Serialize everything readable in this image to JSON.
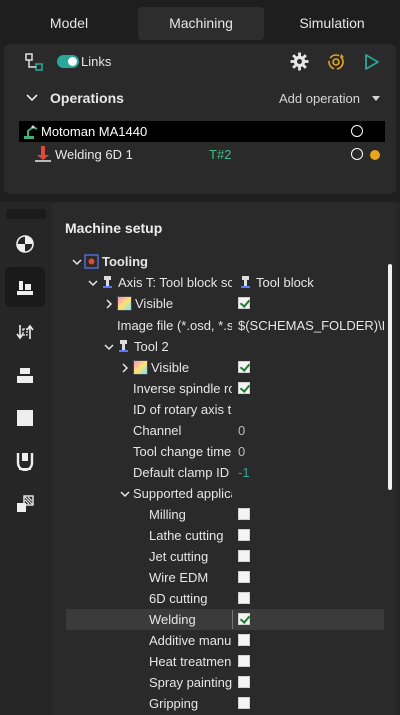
{
  "tabs": [
    "Model",
    "Machining",
    "Simulation"
  ],
  "active_tab": "Machining",
  "operations_toolbar": {
    "links_label": "Links",
    "links_enabled": true
  },
  "operations": {
    "title": "Operations",
    "add_operation_label": "Add operation",
    "items": [
      {
        "label": "Motoman MA1440"
      },
      {
        "label": "Welding 6D 1",
        "tool": "T#2"
      }
    ]
  },
  "machine_setup": {
    "title": "Machine setup",
    "tree": [
      {
        "label": "Tooling"
      },
      {
        "label": "Axis T: Tool block sc",
        "value": "Tool block"
      },
      {
        "label": "Visible",
        "checked": true
      },
      {
        "label": "Image file (*.osd, *.s",
        "value": "$(SCHEMAS_FOLDER)\\Rc"
      },
      {
        "label": "Tool 2"
      },
      {
        "label": "Visible",
        "checked": true
      },
      {
        "label": "Inverse spindle ro",
        "checked": true
      },
      {
        "label": "ID of rotary axis t",
        "value": ""
      },
      {
        "label": "Channel",
        "value": "0"
      },
      {
        "label": "Tool change time",
        "value": "0"
      },
      {
        "label": "Default clamp ID",
        "value": "-1"
      },
      {
        "label": "Supported applica"
      },
      {
        "label": "Milling",
        "checked": false
      },
      {
        "label": "Lathe cutting",
        "checked": false
      },
      {
        "label": "Jet cutting",
        "checked": false
      },
      {
        "label": "Wire EDM",
        "checked": false
      },
      {
        "label": "6D cutting",
        "checked": false
      },
      {
        "label": "Welding",
        "checked": true
      },
      {
        "label": "Additive manu",
        "checked": false
      },
      {
        "label": "Heat treatmen",
        "checked": false
      },
      {
        "label": "Spray painting",
        "checked": false
      },
      {
        "label": "Gripping",
        "checked": false
      }
    ]
  },
  "colors": {
    "accent_teal": "#2aa79b",
    "tool_ref_green": "#3dbf8e",
    "status_yellow": "#e8a51c",
    "selection_bg": "#3b3b3b"
  },
  "icons": [
    "links-icon",
    "gear-icon",
    "simulation-icon",
    "play-icon",
    "robot-icon",
    "welding-icon",
    "tooling-icon",
    "visible-icon",
    "tool-icon"
  ]
}
